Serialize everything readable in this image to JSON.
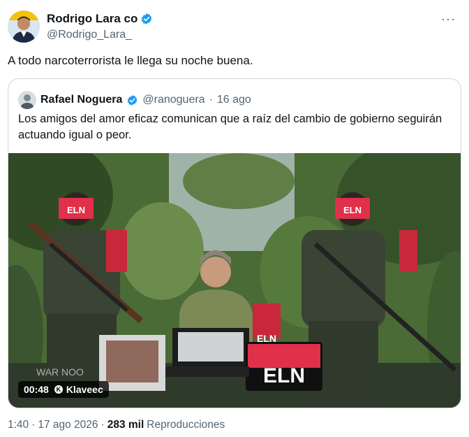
{
  "author": {
    "name": "Rodrigo Lara co",
    "handle": "@Rodrigo_Lara_",
    "verified": true,
    "more_icon": "ellipsis-icon"
  },
  "tweet": {
    "text": "A todo narcoterrorista le llega su noche buena."
  },
  "quote": {
    "name": "Rafael Noguera",
    "handle": "@ranoguera",
    "separator": "·",
    "time": "16 ago",
    "verified": true,
    "text": "Los amigos del amor eficaz comunican que a raíz del cambio de gobierno seguirán actuando igual o peor.",
    "media": {
      "duration": "00:48",
      "source": "Klaveec",
      "mask_text_left": "ELN",
      "mask_text_right": "ELN",
      "banner_text": "ELN",
      "small_sign": "ELN",
      "watermark": "WAR NOO"
    }
  },
  "meta": {
    "time": "1:40",
    "separator": "·",
    "date": "17 ago 2026",
    "separator2": "·",
    "views": "283 mil",
    "views_label": "Reproducciones"
  },
  "colors": {
    "verified": "#1d9bf0",
    "muted": "#536471",
    "border": "#cfd9de",
    "eln_red": "#e0304a"
  }
}
